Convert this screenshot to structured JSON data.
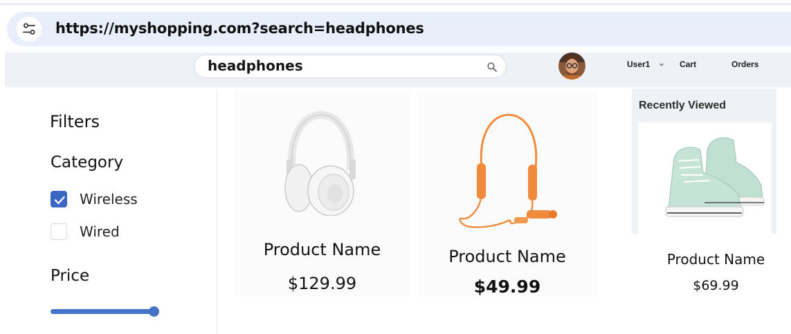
{
  "browser": {
    "url": "https://myshopping.com?search=headphones",
    "site_info_icon": "tune-icon"
  },
  "header": {
    "search_value": "headphones",
    "search_icon": "search-icon",
    "user_label": "User1",
    "cart_label": "Cart",
    "orders_label": "Orders"
  },
  "filters": {
    "title": "Filters",
    "category_title": "Category",
    "options": [
      {
        "label": "Wireless",
        "checked": true
      },
      {
        "label": "Wired",
        "checked": false
      }
    ],
    "price_title": "Price",
    "price_slider_level": 1.0
  },
  "products": [
    {
      "name": "Product Name",
      "price": "$129.99",
      "image": "over-ear-headphones"
    },
    {
      "name": "Product Name",
      "price": "$49.99",
      "image": "neckband-earbuds"
    },
    {
      "name": "Product Name",
      "price": "$69.99",
      "image": "high-top-sneaker"
    }
  ],
  "recently_viewed": {
    "title": "Recently Viewed",
    "image": "high-top-sneaker"
  },
  "colors": {
    "accent": "#4472c4",
    "checkbox_checked": "#3a67c4",
    "address_bar": "#e9eefb",
    "neckband": "#f08a3c"
  }
}
